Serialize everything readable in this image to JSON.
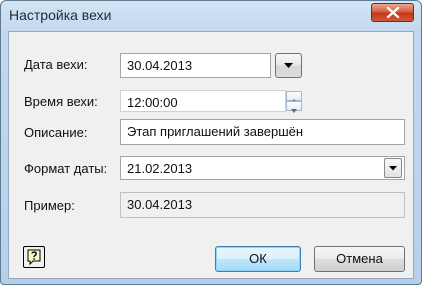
{
  "window": {
    "title": "Настройка вехи"
  },
  "form": {
    "date_label": "Дата вехи:",
    "date_value": "30.04.2013",
    "time_label": "Время вехи:",
    "time_value": "12:00:00",
    "description_label": "Описание:",
    "description_value": "Этап приглашений завершён",
    "format_label": "Формат даты:",
    "format_value": "21.02.2013",
    "example_label": "Пример:",
    "example_value": "30.04.2013"
  },
  "buttons": {
    "ok": "ОК",
    "cancel": "Отмена"
  },
  "icons": {
    "close": "close-icon",
    "date_dropdown": "chevron-down-icon",
    "format_dropdown": "chevron-down-icon",
    "spin_up": "arrow-up-icon",
    "spin_down": "arrow-down-icon",
    "help": "help-icon"
  },
  "colors": {
    "title_bar": "#c3d8ef",
    "close_button": "#c8452a",
    "default_button_border": "#3c7fb1",
    "client_background": "#f0f0f0"
  }
}
